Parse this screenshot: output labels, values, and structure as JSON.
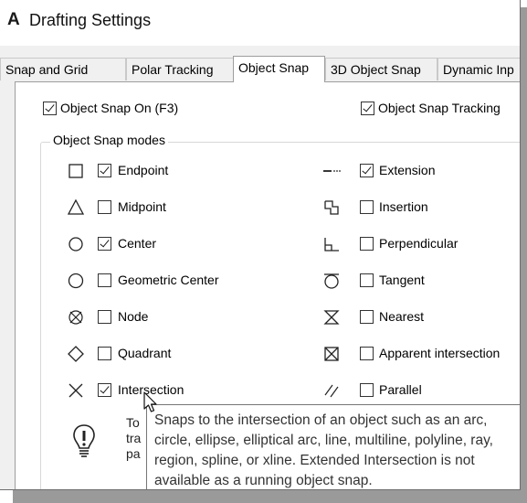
{
  "window": {
    "app_icon": "A",
    "title": "Drafting Settings"
  },
  "tabs": [
    {
      "label": "Snap and Grid",
      "active": false
    },
    {
      "label": "Polar Tracking",
      "active": false
    },
    {
      "label": "Object Snap",
      "active": true
    },
    {
      "label": "3D Object Snap",
      "active": false
    },
    {
      "label": "Dynamic Inp",
      "active": false
    }
  ],
  "options": {
    "osnap_on": {
      "label": "Object Snap On (F3)",
      "checked": true
    },
    "osnap_tracking": {
      "label": "Object Snap Tracking",
      "checked": true
    }
  },
  "modes_group": {
    "label": "Object Snap modes",
    "left": [
      {
        "label": "Endpoint",
        "checked": true,
        "icon": "endpoint-square-icon"
      },
      {
        "label": "Midpoint",
        "checked": false,
        "icon": "midpoint-triangle-icon"
      },
      {
        "label": "Center",
        "checked": true,
        "icon": "center-circle-icon"
      },
      {
        "label": "Geometric Center",
        "checked": false,
        "icon": "geometric-center-icon"
      },
      {
        "label": "Node",
        "checked": false,
        "icon": "node-icon"
      },
      {
        "label": "Quadrant",
        "checked": false,
        "icon": "quadrant-diamond-icon"
      },
      {
        "label": "Intersection",
        "checked": true,
        "icon": "intersection-x-icon"
      }
    ],
    "right": [
      {
        "label": "Extension",
        "checked": true,
        "icon": "extension-icon"
      },
      {
        "label": "Insertion",
        "checked": false,
        "icon": "insertion-icon"
      },
      {
        "label": "Perpendicular",
        "checked": false,
        "icon": "perpendicular-icon"
      },
      {
        "label": "Tangent",
        "checked": false,
        "icon": "tangent-icon"
      },
      {
        "label": "Nearest",
        "checked": false,
        "icon": "nearest-hourglass-icon"
      },
      {
        "label": "Apparent intersection",
        "checked": false,
        "icon": "apparent-intersection-icon"
      },
      {
        "label": "Parallel",
        "checked": false,
        "icon": "parallel-icon"
      }
    ]
  },
  "hint": {
    "line1": "To",
    "line2": "tra",
    "line3": "pa"
  },
  "tooltip": {
    "text": "Snaps to the intersection of an object such as an arc, circle, ellipse, elliptical arc, line, multiline, polyline, ray, region, spline, or xline. Extended Intersection is not available as a running object snap."
  }
}
